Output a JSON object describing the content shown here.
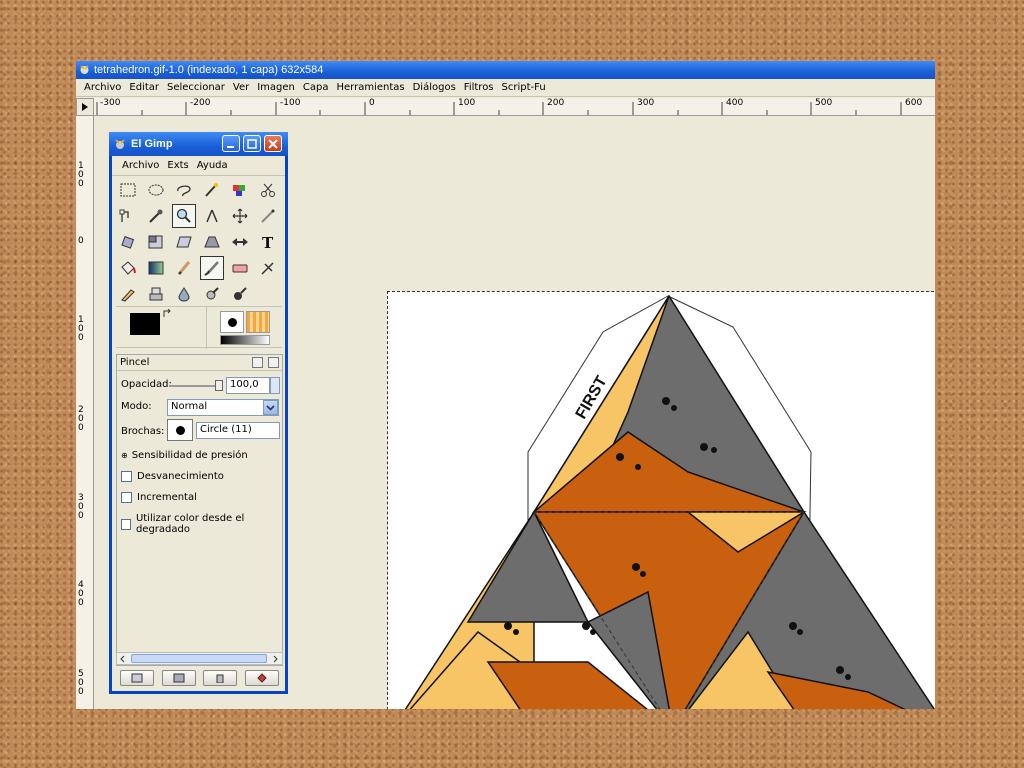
{
  "window": {
    "title": "tetrahedron.gif-1.0 (indexado, 1 capa) 632x584",
    "menu": [
      "Archivo",
      "Editar",
      "Seleccionar",
      "Ver",
      "Imagen",
      "Capa",
      "Herramientas",
      "Diálogos",
      "Filtros",
      "Script-Fu"
    ]
  },
  "rulers": {
    "horizontal": [
      "-300",
      "-200",
      "-100",
      "0",
      "100",
      "200",
      "300",
      "400",
      "500",
      "600"
    ],
    "vertical": [
      "100",
      "0",
      "100",
      "200",
      "300",
      "400",
      "500"
    ]
  },
  "toolbox": {
    "title": "El Gimp",
    "menu": [
      "Archivo",
      "Exts",
      "Ayuda"
    ],
    "tools": [
      "rect-select-icon",
      "ellipse-select-icon",
      "lasso-icon",
      "fuzzy-select-icon",
      "color-select-icon",
      "scissors-icon",
      "paths-icon",
      "color-picker-icon",
      "zoom-icon",
      "measure-icon",
      "move-icon",
      "crop-icon",
      "rotate-icon",
      "scale-icon",
      "shear-icon",
      "perspective-icon",
      "flip-icon",
      "text-icon",
      "bucket-fill-icon",
      "blend-icon",
      "pencil-icon",
      "paintbrush-icon",
      "eraser-icon",
      "airbrush-icon",
      "ink-icon",
      "clone-icon",
      "blur-icon",
      "smudge-icon",
      "dodge-burn-icon"
    ],
    "active_tool": "paintbrush-icon"
  },
  "tool_options": {
    "title": "Pincel",
    "opacity_label": "Opacidad:",
    "opacity_value": "100,0",
    "opacity_level": 1.0,
    "mode_label": "Modo:",
    "mode_value": "Normal",
    "brush_label": "Brochas:",
    "brush_value": "Circle (11)",
    "pressure_label": "Sensibilidad de presión",
    "checkboxes": [
      {
        "label": "Desvanecimiento",
        "checked": false
      },
      {
        "label": "Incremental",
        "checked": false
      },
      {
        "label": "Utilizar color desde el degradado",
        "checked": false
      }
    ]
  },
  "canvas": {
    "first_label": "FIRST",
    "colors": {
      "grey": "#6d6d6d",
      "yellow": "#f7c566",
      "orange": "#c9600f",
      "outline": "#111111"
    }
  }
}
